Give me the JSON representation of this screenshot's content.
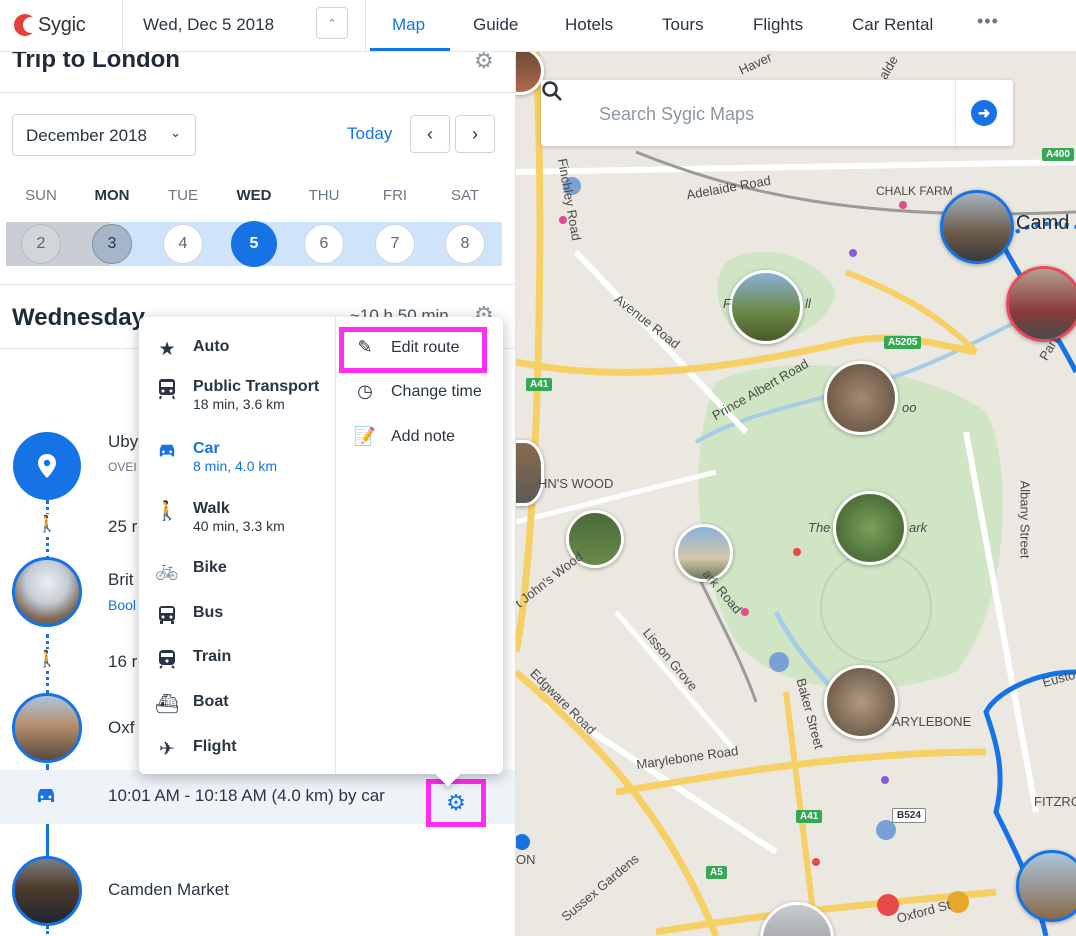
{
  "topbar": {
    "logo_text": "Sygic",
    "date": "Wed, Dec 5 2018",
    "tabs": [
      "Map",
      "Guide",
      "Hotels",
      "Tours",
      "Flights",
      "Car Rental"
    ],
    "more": "•••"
  },
  "trip": {
    "title": "Trip to London",
    "month_select": "December 2018",
    "today_label": "Today",
    "weekdays": [
      "SUN",
      "MON",
      "TUE",
      "WED",
      "THU",
      "FRI",
      "SAT"
    ],
    "days": [
      "2",
      "3",
      "4",
      "5",
      "6",
      "7",
      "8"
    ],
    "selected_day": "5",
    "day_heading": "Wednesday",
    "day_duration": "~10 h 50 min"
  },
  "timeline": {
    "item1_title": "Uby",
    "item1_sub": "OVEI",
    "walk1": "25 r",
    "item2_title": "Brit",
    "item2_link": "Bool",
    "walk2": "16 r",
    "item3_title": "Oxf",
    "route_text": "10:01 AM - 10:18 AM (4.0 km) by car",
    "item4_title": "Camden Market"
  },
  "popup": {
    "modes": [
      {
        "label": "Auto",
        "sub": "",
        "icon": "star-icon"
      },
      {
        "label": "Public Transport",
        "sub": "18 min, 3.6 km",
        "icon": "public-transport-icon"
      },
      {
        "label": "Car",
        "sub": "8 min, 4.0 km",
        "icon": "car-icon"
      },
      {
        "label": "Walk",
        "sub": "40 min, 3.3 km",
        "icon": "walk-icon"
      },
      {
        "label": "Bike",
        "sub": "",
        "icon": "bike-icon"
      },
      {
        "label": "Bus",
        "sub": "",
        "icon": "bus-icon"
      },
      {
        "label": "Train",
        "sub": "",
        "icon": "train-icon"
      },
      {
        "label": "Boat",
        "sub": "",
        "icon": "boat-icon"
      },
      {
        "label": "Flight",
        "sub": "",
        "icon": "flight-icon"
      }
    ],
    "active_mode": "Car",
    "actions": [
      "Edit route",
      "Change time",
      "Add note"
    ]
  },
  "map": {
    "search_placeholder": "Search Sygic Maps",
    "labels": {
      "adelaide_road": "Adelaide Road",
      "chalk_farm": "CHALK FARM",
      "camden": "Camd",
      "avenue_road": "Avenue Road",
      "prince_albert_road": "Prince Albert Road",
      "st_johns_wood": "HN'S WOOD",
      "the_park": "The",
      "park_suffix": "ark",
      "zoo_suffix": "oo",
      "primrose_letter": "F",
      "primrose_suffix": "ll",
      "albany_street": "Albany Street",
      "lisson_grove": "Lisson Grove",
      "edgware_road": "Edgware Road",
      "baker_street": "Baker Street",
      "marylebone_road": "Marylebone Road",
      "marylebone": "ARYLEBONE",
      "fitzrovia": "FITZRO",
      "sussex_gardens": "Sussex Gardens",
      "oxford_st": "Oxford St",
      "euston": "Euston",
      "park_road": "Park",
      "john_wood": "t John's Wood",
      "park_road_label": "ark Road",
      "finchley": "Finchley Road",
      "haver": "Haver",
      "alde": "alde",
      "on_label": "ON",
      "a41": "A41",
      "a5205": "A5205",
      "a41b": "A41",
      "a5": "A5",
      "b524": "B524",
      "a400": "A400"
    }
  }
}
